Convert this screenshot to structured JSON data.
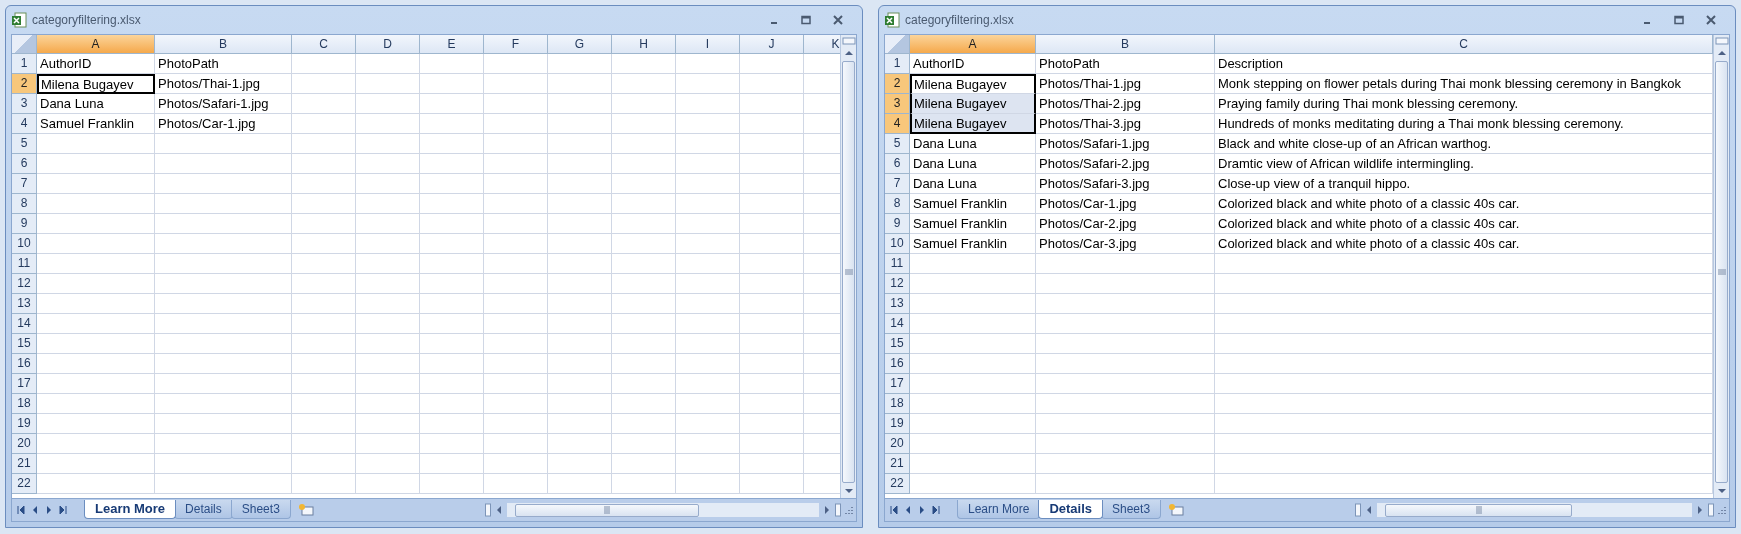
{
  "windows": [
    {
      "title": "categoryfiltering.xlsx",
      "columns": [
        {
          "label": "A",
          "selected": true
        },
        {
          "label": "B",
          "selected": false
        },
        {
          "label": "C",
          "selected": false
        },
        {
          "label": "D",
          "selected": false
        },
        {
          "label": "E",
          "selected": false
        },
        {
          "label": "F",
          "selected": false
        },
        {
          "label": "G",
          "selected": false
        },
        {
          "label": "H",
          "selected": false
        },
        {
          "label": "I",
          "selected": false
        },
        {
          "label": "J",
          "selected": false
        },
        {
          "label": "K",
          "selected": false
        }
      ],
      "rows": [
        {
          "number": "1",
          "selected": false,
          "cells": [
            "AuthorID",
            "PhotoPath"
          ]
        },
        {
          "number": "2",
          "selected": true,
          "cells": [
            "Milena Bugayev",
            "Photos/Thai-1.jpg"
          ]
        },
        {
          "number": "3",
          "selected": false,
          "cells": [
            "Dana Luna",
            "Photos/Safari-1.jpg"
          ]
        },
        {
          "number": "4",
          "selected": false,
          "cells": [
            "Samuel Franklin",
            "Photos/Car-1.jpg"
          ]
        },
        {
          "number": "5",
          "selected": false,
          "cells": []
        },
        {
          "number": "6",
          "selected": false,
          "cells": []
        },
        {
          "number": "7",
          "selected": false,
          "cells": []
        },
        {
          "number": "8",
          "selected": false,
          "cells": []
        },
        {
          "number": "9",
          "selected": false,
          "cells": []
        },
        {
          "number": "10",
          "selected": false,
          "cells": []
        },
        {
          "number": "11",
          "selected": false,
          "cells": []
        },
        {
          "number": "12",
          "selected": false,
          "cells": []
        },
        {
          "number": "13",
          "selected": false,
          "cells": []
        },
        {
          "number": "14",
          "selected": false,
          "cells": []
        },
        {
          "number": "15",
          "selected": false,
          "cells": []
        },
        {
          "number": "16",
          "selected": false,
          "cells": []
        },
        {
          "number": "17",
          "selected": false,
          "cells": []
        },
        {
          "number": "18",
          "selected": false,
          "cells": []
        },
        {
          "number": "19",
          "selected": false,
          "cells": []
        },
        {
          "number": "20",
          "selected": false,
          "cells": []
        },
        {
          "number": "21",
          "selected": false,
          "cells": []
        },
        {
          "number": "22",
          "selected": false,
          "cells": []
        }
      ],
      "tabs": [
        {
          "label": "Learn More",
          "selected": true
        },
        {
          "label": "Details",
          "selected": false
        },
        {
          "label": "Sheet3",
          "selected": false
        }
      ]
    },
    {
      "title": "categoryfiltering.xlsx",
      "columns": [
        {
          "label": "A",
          "selected": true
        },
        {
          "label": "B",
          "selected": false
        },
        {
          "label": "C",
          "selected": false
        }
      ],
      "rows": [
        {
          "number": "1",
          "selected": false,
          "cells": [
            "AuthorID",
            "PhotoPath",
            "Description"
          ]
        },
        {
          "number": "2",
          "selected": true,
          "cells": [
            "Milena Bugayev",
            "Photos/Thai-1.jpg",
            "Monk stepping on flower petals during Thai monk blessing ceremony in Bangkok"
          ]
        },
        {
          "number": "3",
          "selected": true,
          "cells": [
            "Milena Bugayev",
            "Photos/Thai-2.jpg",
            "Praying family during Thai monk blessing ceremony."
          ]
        },
        {
          "number": "4",
          "selected": true,
          "cells": [
            "Milena Bugayev",
            "Photos/Thai-3.jpg",
            "Hundreds of monks meditating during a Thai monk blessing ceremony."
          ]
        },
        {
          "number": "5",
          "selected": false,
          "cells": [
            "Dana Luna",
            "Photos/Safari-1.jpg",
            "Black and white close-up of an African warthog."
          ]
        },
        {
          "number": "6",
          "selected": false,
          "cells": [
            "Dana Luna",
            "Photos/Safari-2.jpg",
            "Dramtic view of African wildlife intermingling."
          ]
        },
        {
          "number": "7",
          "selected": false,
          "cells": [
            "Dana Luna",
            "Photos/Safari-3.jpg",
            "Close-up view of a tranquil hippo."
          ]
        },
        {
          "number": "8",
          "selected": false,
          "cells": [
            "Samuel Franklin",
            "Photos/Car-1.jpg",
            "Colorized black and white photo of a classic 40s car."
          ]
        },
        {
          "number": "9",
          "selected": false,
          "cells": [
            "Samuel Franklin",
            "Photos/Car-2.jpg",
            "Colorized black and white photo of a classic 40s car."
          ]
        },
        {
          "number": "10",
          "selected": false,
          "cells": [
            "Samuel Franklin",
            "Photos/Car-3.jpg",
            "Colorized black and white photo of a classic 40s car."
          ]
        },
        {
          "number": "11",
          "selected": false,
          "cells": []
        },
        {
          "number": "12",
          "selected": false,
          "cells": []
        },
        {
          "number": "13",
          "selected": false,
          "cells": []
        },
        {
          "number": "14",
          "selected": false,
          "cells": []
        },
        {
          "number": "15",
          "selected": false,
          "cells": []
        },
        {
          "number": "16",
          "selected": false,
          "cells": []
        },
        {
          "number": "17",
          "selected": false,
          "cells": []
        },
        {
          "number": "18",
          "selected": false,
          "cells": []
        },
        {
          "number": "19",
          "selected": false,
          "cells": []
        },
        {
          "number": "20",
          "selected": false,
          "cells": []
        },
        {
          "number": "21",
          "selected": false,
          "cells": []
        },
        {
          "number": "22",
          "selected": false,
          "cells": []
        }
      ],
      "tabs": [
        {
          "label": "Learn More",
          "selected": false
        },
        {
          "label": "Details",
          "selected": true
        },
        {
          "label": "Sheet3",
          "selected": false
        }
      ]
    }
  ]
}
